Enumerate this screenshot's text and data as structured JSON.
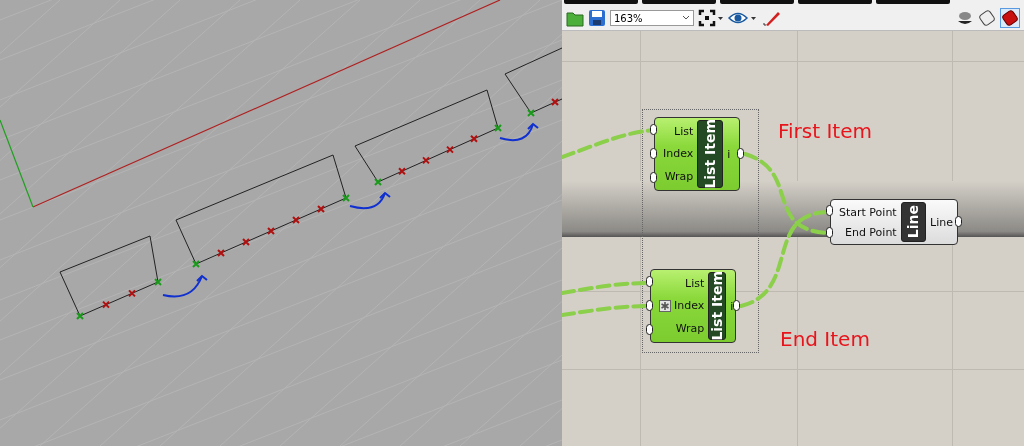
{
  "toolbar": {
    "zoom": "163%"
  },
  "components": [
    {
      "title": "List Item",
      "selected": true,
      "inputs": [
        {
          "label": "List",
          "flagged": false
        },
        {
          "label": "Index",
          "flagged": false
        },
        {
          "label": "Wrap",
          "flagged": false
        }
      ],
      "outputs": [
        "i"
      ]
    },
    {
      "title": "List Item",
      "selected": true,
      "inputs": [
        {
          "label": "List",
          "flagged": false
        },
        {
          "label": "Index",
          "flagged": true
        },
        {
          "label": "Wrap",
          "flagged": false
        }
      ],
      "outputs": [
        "i"
      ]
    },
    {
      "title": "Line",
      "selected": false,
      "inputs": [
        {
          "label": "Start Point",
          "flagged": false
        },
        {
          "label": "End Point",
          "flagged": false
        }
      ],
      "outputs": [
        "Line"
      ]
    }
  ],
  "annotations": [
    "First Item",
    "End Item"
  ]
}
